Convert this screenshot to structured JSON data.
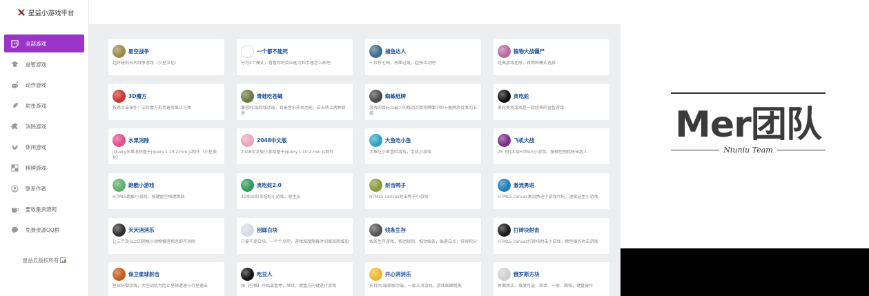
{
  "app": {
    "title": "星益小游戏平台"
  },
  "sidebar": {
    "items": [
      {
        "label": "全部游戏",
        "icon": "twitch-icon",
        "active": true
      },
      {
        "label": "益智游戏",
        "icon": "graduation-cap-icon",
        "active": false
      },
      {
        "label": "动作游戏",
        "icon": "reddit-icon",
        "active": false
      },
      {
        "label": "射击游戏",
        "icon": "rocket-icon",
        "active": false
      },
      {
        "label": "消除游戏",
        "icon": "puzzle-icon",
        "active": false
      },
      {
        "label": "休闲游戏",
        "icon": "bird-icon",
        "active": false
      },
      {
        "label": "棋牌游戏",
        "icon": "chessboard-icon",
        "active": false
      },
      {
        "label": "联系作者",
        "icon": "user-icon",
        "active": false
      },
      {
        "label": "要收集资源网",
        "icon": "coffee-icon",
        "active": false
      },
      {
        "label": "免费资源QQ群",
        "icon": "chat-icon",
        "active": false
      }
    ],
    "copyright": "星益云版权所有"
  },
  "games": [
    {
      "title": "星空战争",
      "desc": "超好玩的卡片战争游戏（小星汉化）",
      "color": "#9a8a4c"
    },
    {
      "title": "一个都不能死",
      "desc": "分为4个模式，看看你的反应能力和手速怎么样吧",
      "color": "#ffffff"
    },
    {
      "title": "捕鱼达人",
      "desc": "一共有七档，界面过缓，超快活动吧",
      "color": "#3d6d88"
    },
    {
      "title": "植物大战僵尸",
      "desc": "经典游戏还原，有两种模式选择",
      "color": "#b86aa0"
    },
    {
      "title": "3D魔方",
      "desc": "按惑点击操作：三阶魔方形状遍常显正方体",
      "color": "#c8362f"
    },
    {
      "title": "青蛙吃苍蝇",
      "desc": "兼容PC端和移动端，背景音乐开关功能，白天转上两种背景",
      "color": "#6b7a3e"
    },
    {
      "title": "蜘蛛纸牌",
      "desc": "游戏的目标以最少的移动次数将牌面中的十叠牌及待发的五组",
      "color": "#4a4a4a"
    },
    {
      "title": "贪吃蛇",
      "desc": "美轮美奂游戏是一款经典的益智游戏",
      "color": "#111111"
    },
    {
      "title": "水果消除",
      "desc": "jQuery水果消除基于jquery.1.10.2.min.js制作（小星美化）",
      "color": "#e24d8a"
    },
    {
      "title": "2048中文版",
      "desc": "2048中文版小游戏基于jquery.1.10.2.min.js制作",
      "color": "#e9a6b8"
    },
    {
      "title": "大鱼吃小鱼",
      "desc": "大鱼吃小鱼冒险游戏，手机小游戏",
      "color": "#2fa3c1"
    },
    {
      "title": "飞机大战",
      "desc": "26飞机大战HTML5小游戏，按框控制机枪击敌人",
      "color": "#7a2f8c"
    },
    {
      "title": "跑酷小游戏",
      "desc": "HTML5跑酷小游戏，按键盘空格键跳跃",
      "color": "#5fae6a"
    },
    {
      "title": "贪吃蛇2.0",
      "desc": "3D和说的贪吃蛇小游戏，原生JS",
      "color": "#2f9b5a"
    },
    {
      "title": "射击鸭子",
      "desc": "HTML5 canvas射击鸭子小游戏",
      "color": "#8a9b3a"
    },
    {
      "title": "激流勇进",
      "desc": "HTML5 canvas激流勇进小游戏代码，速度选生小游戏",
      "color": "#1f7fb8"
    },
    {
      "title": "天天消消乐",
      "desc": "让三个及以上的网格小动物横竖相连即可消除",
      "color": "#2f2f2f"
    },
    {
      "title": "别踩白块",
      "desc": "只要不是白块，一个个点吧，游戏难度随着时间增加而增加",
      "color": "#d8d8e8"
    },
    {
      "title": "线条生存",
      "desc": "线条生存游戏，移动规则，推动线条，躲避白点，获得积分",
      "color": "#555555"
    },
    {
      "title": "打砖块射击",
      "desc": "HTML5 canvas打砖块射击小游戏，颜色爆炸射击游戏",
      "color": "#1a1a1a"
    },
    {
      "title": "保卫星球射击",
      "desc": "星球防御游戏，大空战机为阻止星球遭遇小行星撞击",
      "color": "#c65a1d"
    },
    {
      "title": "吃豆人",
      "desc": "按【空格】开始或暂停，继续，键盘方向键进行游戏",
      "color": "#141414"
    },
    {
      "title": "开心消消乐",
      "desc": "支持PC端和移动端，一款三消游戏，游戏画面精美",
      "color": "#f0b732"
    },
    {
      "title": "俄罗斯方块",
      "desc": "界面简洁，难度可选：简单、一般、困难，键盘操作",
      "color": "#cfcfcf"
    }
  ],
  "brand": {
    "name": "Mer团队",
    "subtitle": "Niuniu Team"
  }
}
